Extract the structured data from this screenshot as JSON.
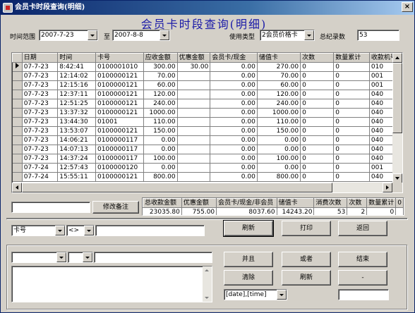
{
  "window": {
    "title": "会员卡时段查询(明细)",
    "close": "×"
  },
  "heading": "会员卡时段查询(明细)",
  "filters": {
    "time_range_label": "时间范围",
    "date_from": "2007-7-23",
    "to_label": "至",
    "date_to": "2007-8-8",
    "use_type_label": "使用类型",
    "use_type_value": "2会员价格卡",
    "total_records_label": "总纪录数",
    "total_records_value": "53"
  },
  "grid": {
    "columns": [
      "日期",
      "时间",
      "卡号",
      "应收金额",
      "优惠金额",
      "会员卡/现金",
      "储值卡",
      "次数",
      "数量累计",
      "收款机号"
    ],
    "rows": [
      [
        "07-7-23",
        "8:42:41",
        "0100001010",
        "300.00",
        "30.00",
        "0.00",
        "270.00",
        "0",
        "0",
        "010"
      ],
      [
        "07-7-23",
        "12:14:02",
        "0100000121",
        "70.00",
        "",
        "0.00",
        "70.00",
        "0",
        "0",
        "001"
      ],
      [
        "07-7-23",
        "12:15:16",
        "0100000121",
        "60.00",
        "",
        "0.00",
        "60.00",
        "0",
        "0",
        "001"
      ],
      [
        "07-7-23",
        "12:37:11",
        "0100000121",
        "120.00",
        "",
        "0.00",
        "120.00",
        "0",
        "0",
        "040"
      ],
      [
        "07-7-23",
        "12:51:25",
        "0100000121",
        "240.00",
        "",
        "0.00",
        "240.00",
        "0",
        "0",
        "040"
      ],
      [
        "07-7-23",
        "13:37:32",
        "0100000121",
        "1000.00",
        "",
        "0.00",
        "1000.00",
        "0",
        "0",
        "040"
      ],
      [
        "07-7-23",
        "13:44:30",
        "01001",
        "110.00",
        "",
        "0.00",
        "110.00",
        "0",
        "0",
        "040"
      ],
      [
        "07-7-23",
        "13:53:07",
        "0100000121",
        "150.00",
        "",
        "0.00",
        "150.00",
        "0",
        "0",
        "040"
      ],
      [
        "07-7-23",
        "14:06:21",
        "0100000117",
        "0.00",
        "",
        "0.00",
        "0.00",
        "0",
        "0",
        "040"
      ],
      [
        "07-7-23",
        "14:07:13",
        "0100000117",
        "0.00",
        "",
        "0.00",
        "0.00",
        "0",
        "0",
        "040"
      ],
      [
        "07-7-23",
        "14:37:24",
        "0100000117",
        "100.00",
        "",
        "0.00",
        "100.00",
        "0",
        "0",
        "040"
      ],
      [
        "07-7-24",
        "12:57:43",
        "0100000120",
        "0.00",
        "",
        "0.00",
        "0.00",
        "0",
        "0",
        "001"
      ],
      [
        "07-7-24",
        "15:55:11",
        "0100000121",
        "800.00",
        "",
        "0.00",
        "800.00",
        "0",
        "0",
        "040"
      ]
    ]
  },
  "remark": {
    "input_value": "",
    "button": "修改备注"
  },
  "summary": {
    "columns": [
      "总收款金额",
      "优惠金额",
      "会员卡/现金/非会员",
      "储值卡",
      "消费次数",
      "次数",
      "数量累计",
      "0"
    ],
    "values": [
      "23035.80",
      "755.00",
      "8037.60",
      "14243.20",
      "53",
      "2",
      "0",
      ""
    ]
  },
  "query": {
    "field_value": "卡号",
    "operator_value": "<>",
    "value": "",
    "refresh": "刷新",
    "print": "打印",
    "back": "返回"
  },
  "builder": {
    "field1_value": "",
    "field2_value": "",
    "field3_value": "",
    "and": "并且",
    "or": "或者",
    "end": "结束",
    "clear": "清除",
    "refresh": "刷新",
    "dash": "-",
    "order_value": "[date],[time]",
    "right_value": ""
  }
}
